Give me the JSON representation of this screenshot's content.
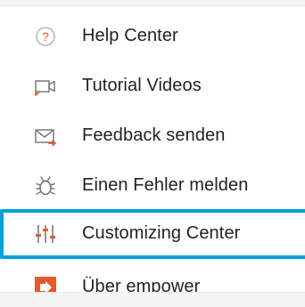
{
  "menu": {
    "items": [
      {
        "label": "Help Center",
        "icon": "help-circle-icon"
      },
      {
        "label": "Tutorial Videos",
        "icon": "video-camera-icon"
      },
      {
        "label": "Feedback senden",
        "icon": "feedback-envelope-icon"
      },
      {
        "label": "Einen Fehler melden",
        "icon": "bug-icon"
      },
      {
        "label": "Customizing Center",
        "icon": "sliders-icon"
      },
      {
        "label": "Über empower",
        "icon": "empower-logo-icon"
      }
    ],
    "highlight_color": "#00a2d9",
    "accent_color": "#e35a2d",
    "icon_gray": "#8c8c8c"
  }
}
